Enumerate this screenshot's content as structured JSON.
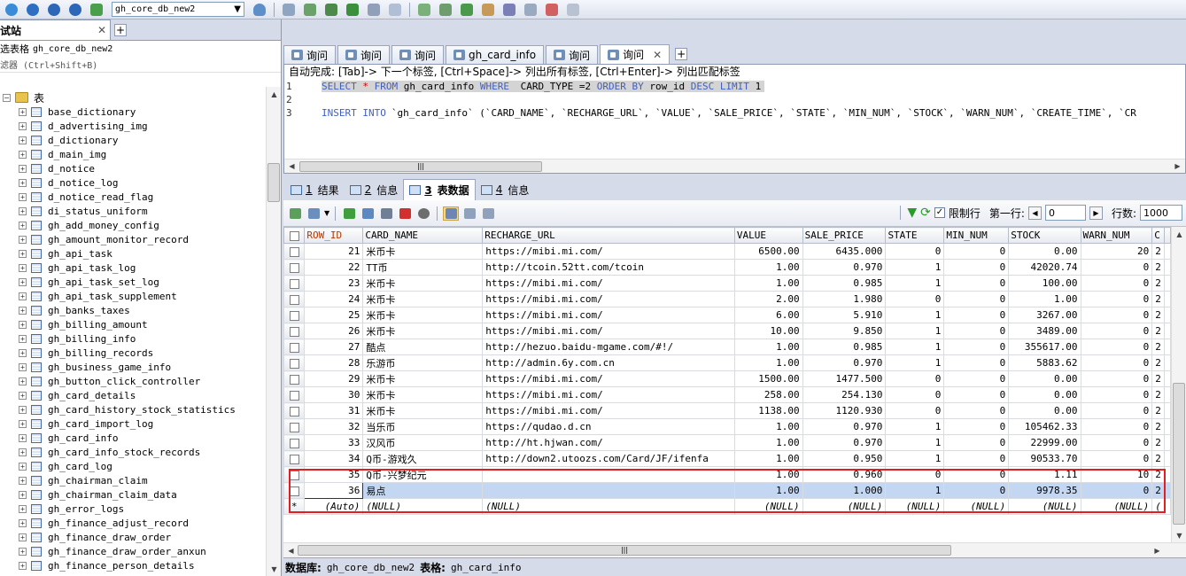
{
  "toolbar": {
    "database_selector": "gh_core_db_new2",
    "icons": [
      "connect-icon",
      "sql-icon",
      "back-icon",
      "forward-icon",
      "new-query-icon",
      "db-icon",
      "backup-icon",
      "import-icon",
      "export-icon",
      "sync-icon",
      "copy-icon",
      "table-icon",
      "schema-icon",
      "tools-icon",
      "monitor-icon",
      "user-icon",
      "server-icon",
      "query-builder-icon",
      "help-icon"
    ]
  },
  "left_panel": {
    "connection_tab": "试站",
    "filter_label": "选表格",
    "filter_value": "gh_core_db_new2",
    "filter_hint": "滤器 (Ctrl+Shift+B)",
    "tables_folder": "表",
    "tables": [
      "base_dictionary",
      "d_advertising_img",
      "d_dictionary",
      "d_main_img",
      "d_notice",
      "d_notice_log",
      "d_notice_read_flag",
      "di_status_uniform",
      "gh_add_money_config",
      "gh_amount_monitor_record",
      "gh_api_task",
      "gh_api_task_log",
      "gh_api_task_set_log",
      "gh_api_task_supplement",
      "gh_banks_taxes",
      "gh_billing_amount",
      "gh_billing_info",
      "gh_billing_records",
      "gh_business_game_info",
      "gh_button_click_controller",
      "gh_card_details",
      "gh_card_history_stock_statistics",
      "gh_card_import_log",
      "gh_card_info",
      "gh_card_info_stock_records",
      "gh_card_log",
      "gh_chairman_claim",
      "gh_chairman_claim_data",
      "gh_error_logs",
      "gh_finance_adjust_record",
      "gh_finance_draw_order",
      "gh_finance_draw_order_anxun",
      "gh_finance_person_details"
    ]
  },
  "query_tabs": [
    {
      "label": "询问",
      "active": false
    },
    {
      "label": "询问",
      "active": false
    },
    {
      "label": "询问",
      "active": false
    },
    {
      "label": "gh_card_info",
      "active": false
    },
    {
      "label": "询问",
      "active": false
    },
    {
      "label": "询问",
      "active": true
    }
  ],
  "editor": {
    "hint": "自动完成: [Tab]-> 下一个标签, [Ctrl+Space]-> 列出所有标签, [Ctrl+Enter]-> 列出匹配标签",
    "line1": {
      "num": "1",
      "kw1": "SELECT",
      "star": "*",
      "kw2": "FROM",
      "t1": "gh_card_info",
      "kw3": "WHERE",
      "t2": "CARD_TYPE =2",
      "kw4": "ORDER BY",
      "t3": "row_id",
      "kw5": "DESC LIMIT",
      "t4": "1"
    },
    "line2": {
      "num": "2"
    },
    "line3": {
      "num": "3",
      "kw1": "INSERT INTO",
      "rest": "`gh_card_info` (`CARD_NAME`, `RECHARGE_URL`, `VALUE`, `SALE_PRICE`, `STATE`, `MIN_NUM`, `STOCK`, `WARN_NUM`, `CREATE_TIME`, `CR"
    }
  },
  "result_tabs": [
    {
      "num": "1",
      "label": "结果",
      "active": false
    },
    {
      "num": "2",
      "label": "信息",
      "active": false
    },
    {
      "num": "3",
      "label": "表数据",
      "active": true
    },
    {
      "num": "4",
      "label": "信息",
      "active": false
    }
  ],
  "grid_toolbar": {
    "limit_rows_label": "限制行",
    "first_row_label": "第一行:",
    "first_row_value": "0",
    "rows_label": "行数:",
    "rows_value": "1000"
  },
  "grid": {
    "columns": [
      "ROW_ID",
      "CARD_NAME",
      "RECHARGE_URL",
      "VALUE",
      "SALE_PRICE",
      "STATE",
      "MIN_NUM",
      "STOCK",
      "WARN_NUM",
      "C"
    ],
    "rows": [
      [
        "21",
        "米币卡",
        "https://mibi.mi.com/",
        "6500.00",
        "6435.000",
        "0",
        "0",
        "0.00",
        "20",
        "2"
      ],
      [
        "22",
        "TT币",
        "http://tcoin.52tt.com/tcoin",
        "1.00",
        "0.970",
        "1",
        "0",
        "42020.74",
        "0",
        "2"
      ],
      [
        "23",
        "米币卡",
        "https://mibi.mi.com/",
        "1.00",
        "0.985",
        "1",
        "0",
        "100.00",
        "0",
        "2"
      ],
      [
        "24",
        "米币卡",
        "https://mibi.mi.com/",
        "2.00",
        "1.980",
        "0",
        "0",
        "1.00",
        "0",
        "2"
      ],
      [
        "25",
        "米币卡",
        "https://mibi.mi.com/",
        "6.00",
        "5.910",
        "1",
        "0",
        "3267.00",
        "0",
        "2"
      ],
      [
        "26",
        "米币卡",
        "https://mibi.mi.com/",
        "10.00",
        "9.850",
        "1",
        "0",
        "3489.00",
        "0",
        "2"
      ],
      [
        "27",
        "酷点",
        "http://hezuo.baidu-mgame.com/#!/",
        "1.00",
        "0.985",
        "1",
        "0",
        "355617.00",
        "0",
        "2"
      ],
      [
        "28",
        "乐游币",
        "http://admin.6y.com.cn",
        "1.00",
        "0.970",
        "1",
        "0",
        "5883.62",
        "0",
        "2"
      ],
      [
        "29",
        "米币卡",
        "https://mibi.mi.com/",
        "1500.00",
        "1477.500",
        "0",
        "0",
        "0.00",
        "0",
        "2"
      ],
      [
        "30",
        "米币卡",
        "https://mibi.mi.com/",
        "258.00",
        "254.130",
        "0",
        "0",
        "0.00",
        "0",
        "2"
      ],
      [
        "31",
        "米币卡",
        "https://mibi.mi.com/",
        "1138.00",
        "1120.930",
        "0",
        "0",
        "0.00",
        "0",
        "2"
      ],
      [
        "32",
        "当乐币",
        "https://qudao.d.cn",
        "1.00",
        "0.970",
        "1",
        "0",
        "105462.33",
        "0",
        "2"
      ],
      [
        "33",
        "汉风币",
        "http://ht.hjwan.com/",
        "1.00",
        "0.970",
        "1",
        "0",
        "22999.00",
        "0",
        "2"
      ],
      [
        "34",
        "Q币-游戏久",
        "http://down2.utoozs.com/Card/JF/ifenfa",
        "1.00",
        "0.950",
        "1",
        "0",
        "90533.70",
        "0",
        "2"
      ],
      [
        "35",
        "Q币-兴梦纪元",
        "",
        "1.00",
        "0.960",
        "0",
        "0",
        "1.11",
        "10",
        "2"
      ],
      [
        "36",
        "易点",
        "",
        "1.00",
        "1.000",
        "1",
        "0",
        "9978.35",
        "0",
        "2"
      ]
    ],
    "new_row": [
      "(Auto)",
      "(NULL)",
      "(NULL)",
      "(NULL)",
      "(NULL)",
      "(NULL)",
      "(NULL)",
      "(NULL)",
      "(NULL)",
      "("
    ],
    "new_row_marker": "*",
    "selected_row_index": 15
  },
  "statusbar": {
    "db_label": "数据库:",
    "db_value": "gh_core_db_new2",
    "table_label": "表格:",
    "table_value": "gh_card_info"
  },
  "colors": {
    "accent": "#3f5fbf",
    "highlight_box": "#e02020",
    "selected_row": "#c4d7f2"
  }
}
